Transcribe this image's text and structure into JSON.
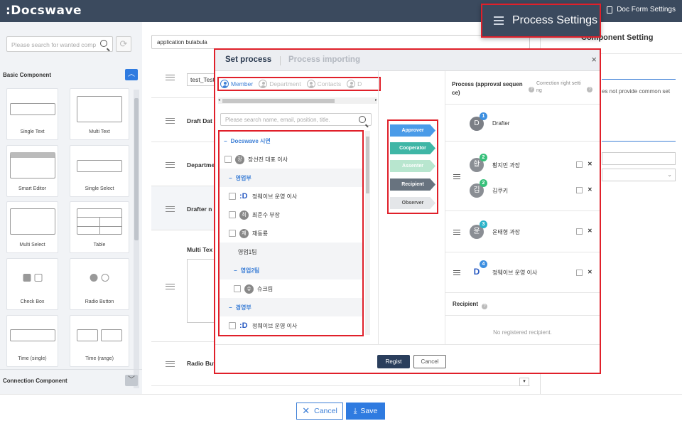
{
  "app": {
    "logo": ":Docswave",
    "doc_form_settings": "Doc Form Settings",
    "process_settings": "Process Settings"
  },
  "left": {
    "search_placeholder": "Please search for wanted comp",
    "basic_title": "Basic Component",
    "connection_title": "Connection Component",
    "components": [
      "Single Text",
      "Multi Text",
      "Smart Editor",
      "Single Select",
      "Multi Select",
      "Table",
      "Check Box",
      "Radio Button",
      "Time (single)",
      "Time (range)"
    ]
  },
  "center": {
    "app_name": "application bulabula",
    "rows": [
      "test_Test",
      "Draft Dat",
      "Departme",
      "Drafter n",
      "Multi Tex",
      "Radio But"
    ]
  },
  "right": {
    "title": "Component Setting",
    "note": "es not provide common set"
  },
  "footer": {
    "cancel": "Cancel",
    "save": "Save"
  },
  "modal": {
    "tab_set": "Set process",
    "tab_import": "Process importing",
    "close": "×",
    "subtabs": [
      "Member",
      "Department",
      "Contacts",
      "D"
    ],
    "search_placeholder": "Please search name, email, position, title.",
    "tree": [
      {
        "label": "Docswave 시연",
        "kind": "group"
      },
      {
        "label": "장선진 대표 이사",
        "kind": "member",
        "av": "장"
      },
      {
        "label": "영업부",
        "kind": "group2"
      },
      {
        "label": "정웨이브 운영 이사",
        "kind": "member",
        "av": "D"
      },
      {
        "label": "최준수 부장",
        "kind": "member",
        "av": "최"
      },
      {
        "label": "재동룡",
        "kind": "member",
        "av": "재"
      },
      {
        "label": "영업1팀",
        "kind": "plain"
      },
      {
        "label": "영업2팀",
        "kind": "group3"
      },
      {
        "label": "슈크림",
        "kind": "member",
        "av": "슈"
      },
      {
        "label": "경영부",
        "kind": "group2"
      },
      {
        "label": "정웨이브 운영 이사",
        "kind": "member",
        "av": "D"
      }
    ],
    "roles": [
      {
        "label": "Approver",
        "color": "#4a9be8"
      },
      {
        "label": "Cooperator",
        "color": "#3fb6a6"
      },
      {
        "label": "Assenter",
        "color": "#b8e6cf"
      },
      {
        "label": "Recipient",
        "color": "#68737f"
      },
      {
        "label": "Observer",
        "color": "#e4e6e9"
      }
    ],
    "process_header": "Process (approval sequence)",
    "process_header_line1": "Process (approval sequen",
    "process_header_line2": "ce)",
    "correction_header_line1": "Correction right setti",
    "correction_header_line2": "ng",
    "process": [
      {
        "step": "1",
        "name": "Drafter",
        "av": "D",
        "badge_color": "#3d8fe0"
      },
      {
        "step": "2",
        "name": "황지민 과장",
        "av": "황",
        "badge_color": "#37c07a"
      },
      {
        "step": "2",
        "name": "김쿠키",
        "av": "김",
        "badge_color": "#37c07a"
      },
      {
        "step": "3",
        "name": "윤태형 과장",
        "av": "윤",
        "badge_color": "#2bb3c9"
      },
      {
        "step": "4",
        "name": "정웨이브 운영 이사",
        "av": "D",
        "badge_color": "#3d8fe0"
      }
    ],
    "recipient_title": "Recipient",
    "no_recipient": "No registered recipient.",
    "regist": "Regist",
    "cancel": "Cancel"
  }
}
